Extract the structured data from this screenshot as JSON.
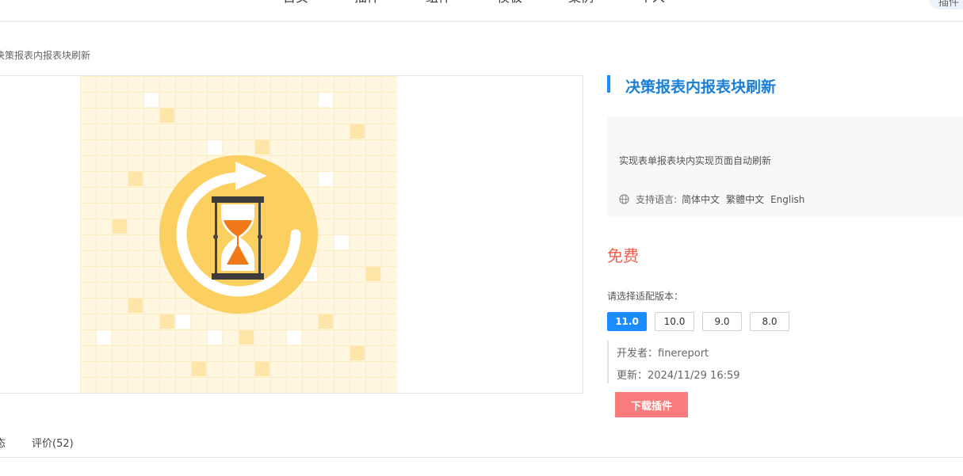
{
  "nav": {
    "items": [
      "首页",
      "插件",
      "组件",
      "模板",
      "案例",
      "个人"
    ],
    "pill": "插件"
  },
  "breadcrumb": "决策报表内报表块刷新",
  "plugin": {
    "title": "决策报表内报表块刷新",
    "description": "实现表单报表块内实现页面自动刷新",
    "languages_label": "支持语言:",
    "languages": [
      "简体中文",
      "繁體中文",
      "English"
    ],
    "price": "免费",
    "version_label": "请选择适配版本：",
    "versions": [
      "11.0",
      "10.0",
      "9.0",
      "8.0"
    ],
    "developer": "开发者：finereport",
    "updated": "更新：2024/11/29 16:59",
    "download_label": "下载插件"
  },
  "tabs": [
    "态",
    "评价(52)"
  ],
  "colors": {
    "accent": "#1a8cff",
    "price": "#f25c4a",
    "download": "#f97b7b",
    "icon_yellow": "#fbd060"
  },
  "icons": [
    "hourglass-refresh-icon",
    "globe-icon"
  ]
}
